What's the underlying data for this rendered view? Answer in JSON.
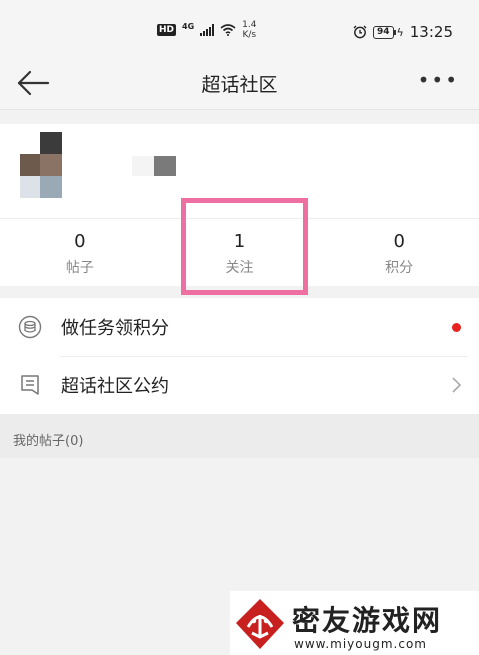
{
  "status_bar": {
    "hd": "HD",
    "network": "4G",
    "speed_value": "1.4",
    "speed_unit": "K/s",
    "battery": "94",
    "time": "13:25"
  },
  "nav": {
    "title": "超话社区"
  },
  "stats": [
    {
      "value": "0",
      "label": "帖子"
    },
    {
      "value": "1",
      "label": "关注"
    },
    {
      "value": "0",
      "label": "积分"
    }
  ],
  "menu": [
    {
      "label": "做任务领积分",
      "icon": "coin-stack-icon",
      "badge": "red-dot"
    },
    {
      "label": "超话社区公约",
      "icon": "document-icon",
      "accessory": "chevron-right-icon"
    }
  ],
  "section": {
    "title": "我的帖子(0)"
  },
  "colors": {
    "highlight": "#ee6fa1",
    "badge": "#e8231f",
    "brand": "#c8201e"
  },
  "watermark": {
    "title": "密友游戏网",
    "url": "www.miyougm.com"
  }
}
